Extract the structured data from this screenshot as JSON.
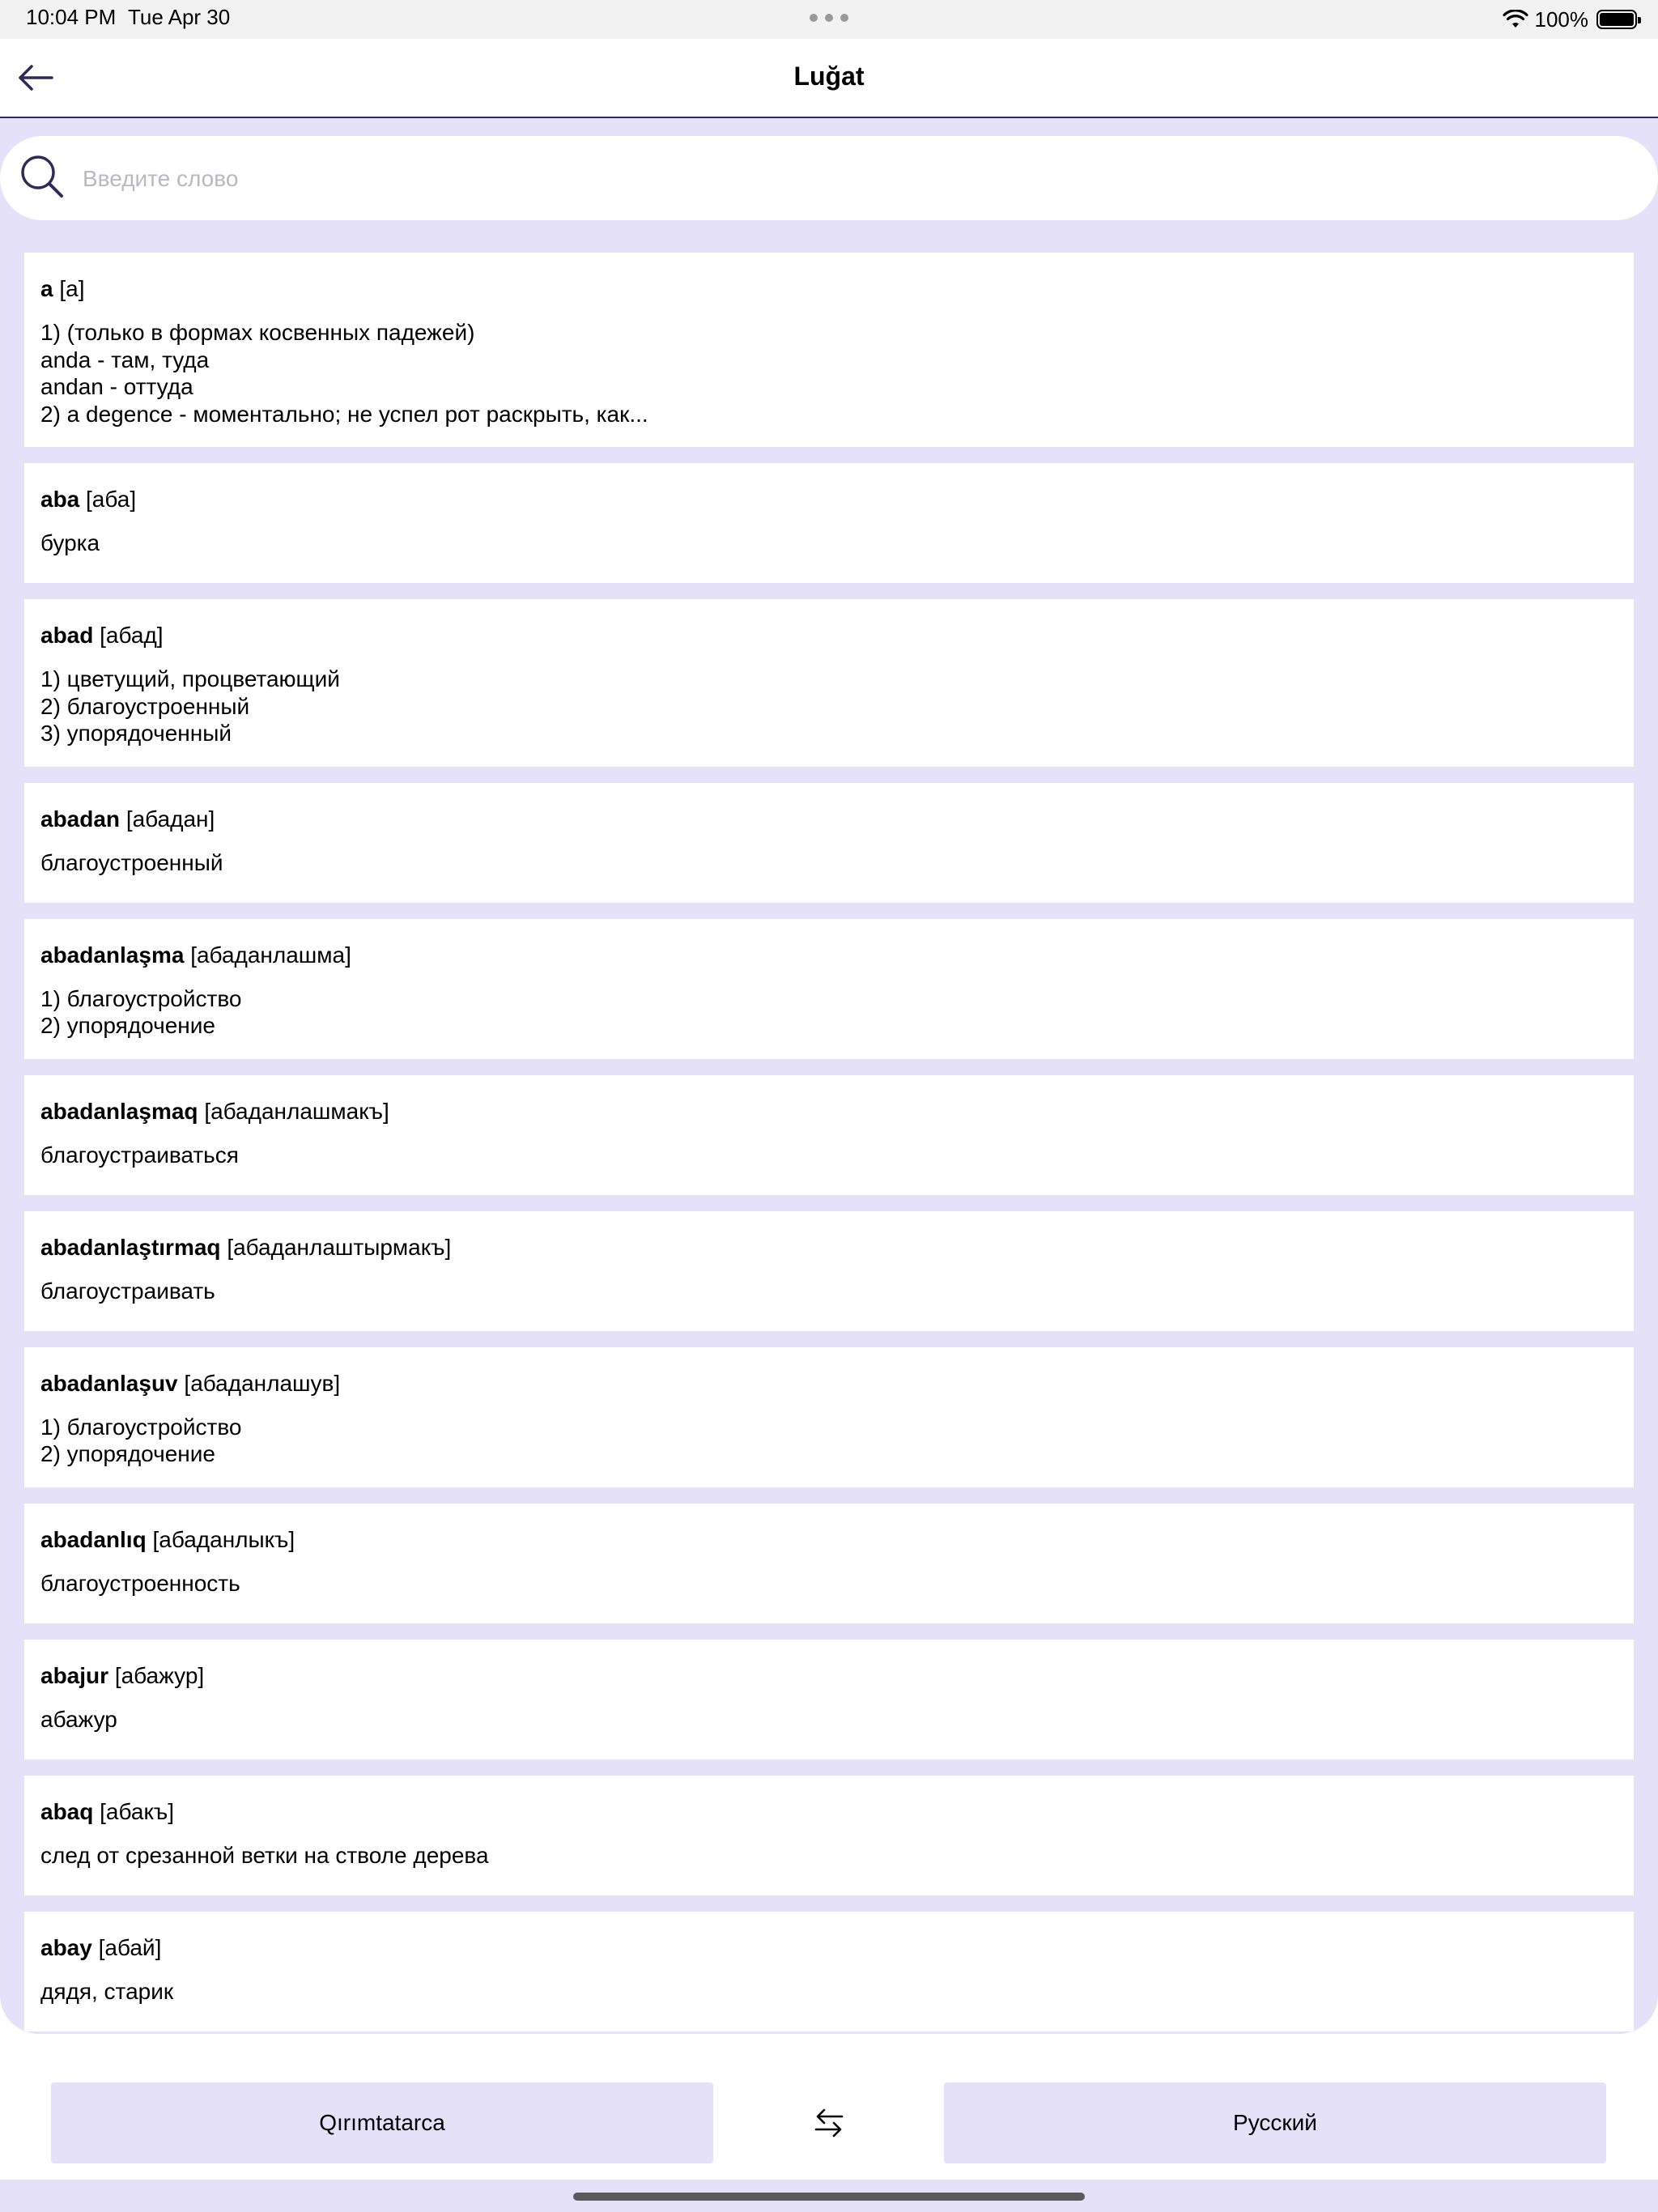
{
  "status_bar": {
    "time": "10:04 PM",
    "date": "Tue Apr 30",
    "battery": "100%",
    "icons": [
      "wifi-icon",
      "battery-icon"
    ]
  },
  "nav": {
    "title": "Luğat",
    "back_icon": "arrow-left-icon"
  },
  "search": {
    "placeholder": "Введите слово",
    "value": "",
    "icon": "search-icon"
  },
  "entries": [
    {
      "word": "a",
      "pron": "[а]",
      "body": "1) (только в формах косвенных падежей)\nanda - там, туда\nandan - оттуда\n2) a degence - моментально; не успел рот раскрыть, как..."
    },
    {
      "word": "aba",
      "pron": "[аба]",
      "body": "бурка"
    },
    {
      "word": "abad",
      "pron": "[абад]",
      "body": "1) цветущий, процветающий\n2) благоустроенный\n3) упорядоченный"
    },
    {
      "word": "abadan",
      "pron": "[абадан]",
      "body": "благоустроенный"
    },
    {
      "word": "abadanlaşma",
      "pron": "[абаданлашма]",
      "body": "1) благоустройство\n2) упорядочение"
    },
    {
      "word": "abadanlaşmaq",
      "pron": "[абаданлашмакъ]",
      "body": "благоустраиваться"
    },
    {
      "word": "abadanlaştırmaq",
      "pron": "[абаданлаштырмакъ]",
      "body": "благоустраивать"
    },
    {
      "word": "abadanlaşuv",
      "pron": "[абаданлашув]",
      "body": "1) благоустройство\n2) упорядочение"
    },
    {
      "word": "abadanlıq",
      "pron": "[абаданлыкъ]",
      "body": "благоустроенность"
    },
    {
      "word": "abajur",
      "pron": "[абажур]",
      "body": "абажур"
    },
    {
      "word": "abaq",
      "pron": "[абакъ]",
      "body": "след от срезанной ветки на стволе дерева"
    },
    {
      "word": "abay",
      "pron": "[абай]",
      "body": "дядя, старик"
    }
  ],
  "language_bar": {
    "source": "Qırımtatarca",
    "target": "Русский",
    "swap_icon": "swap-arrows-icon"
  },
  "colors": {
    "accent_bg": "#e4e1f8",
    "nav_border": "#2e2b5a",
    "icon": "#2e2b5a"
  }
}
